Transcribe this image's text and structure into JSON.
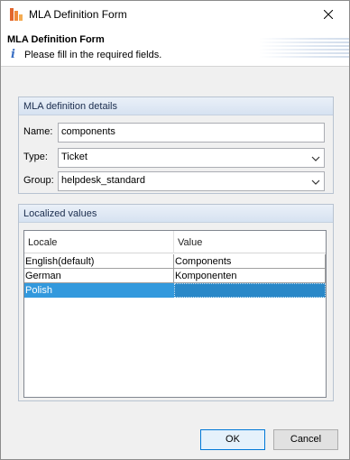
{
  "window": {
    "title": "MLA Definition Form",
    "icon": "app-logo-icon"
  },
  "header": {
    "title": "MLA Definition Form",
    "message": "Please fill in the required fields.",
    "message_icon": "info-icon"
  },
  "details": {
    "heading": "MLA definition details",
    "name": {
      "label": "Name:",
      "value": "components"
    },
    "type": {
      "label": "Type:",
      "value": "Ticket"
    },
    "group": {
      "label": "Group:",
      "value": "helpdesk_standard"
    }
  },
  "localized": {
    "heading": "Localized values",
    "columns": [
      "Locale",
      "Value"
    ],
    "rows": [
      {
        "locale": "English(default)",
        "value": "Components"
      },
      {
        "locale": "German",
        "value": "Komponenten"
      },
      {
        "locale": "Polish",
        "value": ""
      }
    ],
    "selected_row": 2
  },
  "buttons": {
    "ok": "OK",
    "cancel": "Cancel"
  },
  "colors": {
    "selection": "#3399dd",
    "group_border": "#b8c3d1",
    "default_button_border": "#0078d7"
  }
}
